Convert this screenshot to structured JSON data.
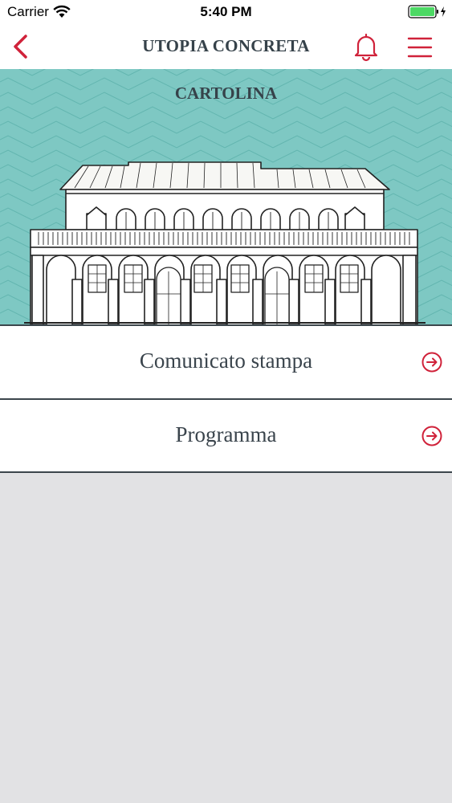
{
  "status_bar": {
    "carrier": "Carrier",
    "time": "5:40 PM"
  },
  "nav": {
    "title": "UTOPIA CONCRETA",
    "icons": [
      "chevron-left-icon",
      "bell-icon",
      "hamburger-menu-icon"
    ]
  },
  "banner": {
    "label": "CARTOLINA"
  },
  "list": [
    {
      "label": "Comunicato stampa",
      "icon": "arrow-circle-right-icon"
    },
    {
      "label": "Programma",
      "icon": "arrow-circle-right-icon"
    }
  ],
  "colors": {
    "accent": "#d0223a",
    "text": "#36424a",
    "banner": "#7ec8c3",
    "background": "#e2e2e4"
  }
}
